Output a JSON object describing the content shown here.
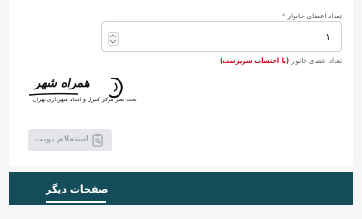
{
  "form": {
    "field_label": "تعداد اعضای خانوار",
    "required_mark": "*",
    "value": "۱",
    "help_text": "تعداد اعضای خانوار",
    "help_warning": "(با احتساب سرپرست)"
  },
  "logo": {
    "brand": "همراه شهر",
    "tagline": "تحت نظر مرکز کنترل و امداد شهرداری تهران"
  },
  "actions": {
    "inquiry_label": "استعلام نوبت"
  },
  "footer": {
    "title": "صفحات دیگر"
  }
}
